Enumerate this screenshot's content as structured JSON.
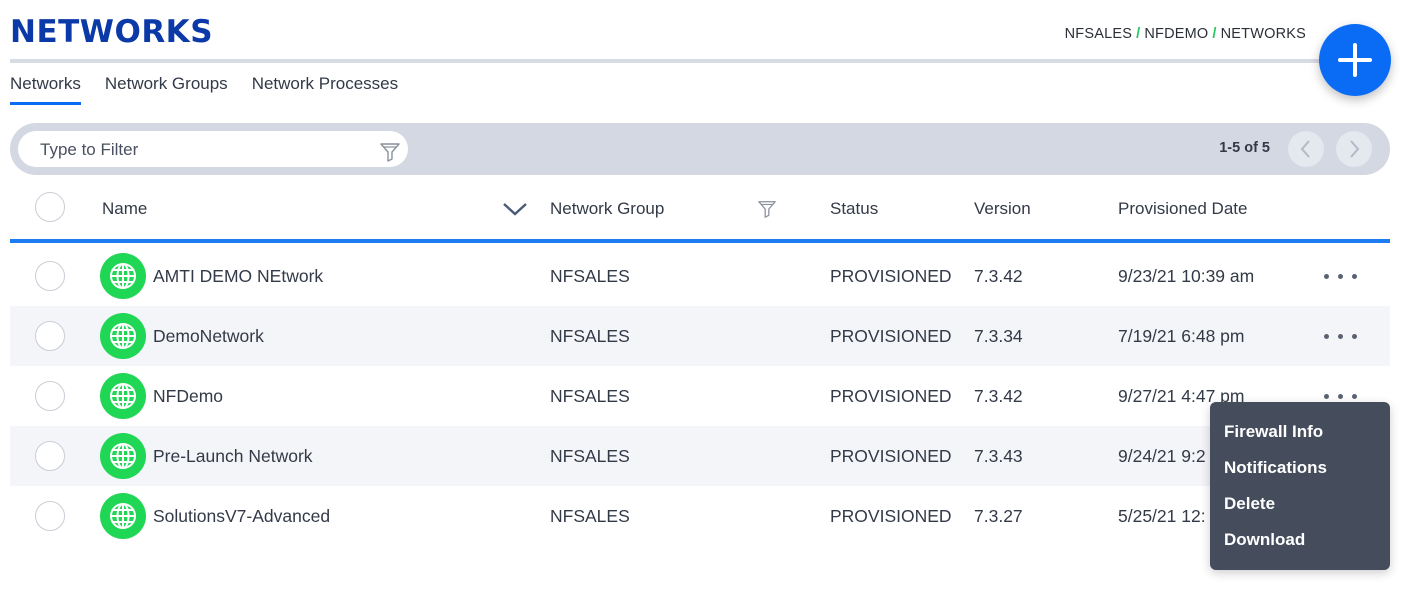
{
  "header": {
    "title": "NETWORKS",
    "breadcrumb": [
      "NFSALES",
      "NFDEMO",
      "NETWORKS"
    ],
    "breadcrumb_separator": "/",
    "add_button_icon": "plus-icon"
  },
  "tabs": [
    {
      "label": "Networks",
      "active": true
    },
    {
      "label": "Network Groups",
      "active": false
    },
    {
      "label": "Network Processes",
      "active": false
    }
  ],
  "filter": {
    "placeholder": "Type to Filter",
    "pager_text": "1-5 of 5"
  },
  "table": {
    "columns": {
      "name": "Name",
      "group": "Network Group",
      "status": "Status",
      "version": "Version",
      "date": "Provisioned Date"
    },
    "rows": [
      {
        "name": "AMTI DEMO NEtwork",
        "group": "NFSALES",
        "status": "PROVISIONED",
        "version": "7.3.42",
        "date": "9/23/21 10:39 am"
      },
      {
        "name": "DemoNetwork",
        "group": "NFSALES",
        "status": "PROVISIONED",
        "version": "7.3.34",
        "date": "7/19/21 6:48 pm"
      },
      {
        "name": "NFDemo",
        "group": "NFSALES",
        "status": "PROVISIONED",
        "version": "7.3.42",
        "date": "9/27/21 4:47 pm"
      },
      {
        "name": "Pre-Launch Network",
        "group": "NFSALES",
        "status": "PROVISIONED",
        "version": "7.3.43",
        "date": "9/24/21 9:2"
      },
      {
        "name": "SolutionsV7-Advanced",
        "group": "NFSALES",
        "status": "PROVISIONED",
        "version": "7.3.27",
        "date": "5/25/21 12:"
      }
    ]
  },
  "context_menu": {
    "items": [
      "Firewall Info",
      "Notifications",
      "Delete",
      "Download"
    ]
  },
  "colors": {
    "brand": "#0b3aa8",
    "accent": "#0a6cf5",
    "status_green": "#1fd655",
    "menu_bg": "#454c5c"
  }
}
